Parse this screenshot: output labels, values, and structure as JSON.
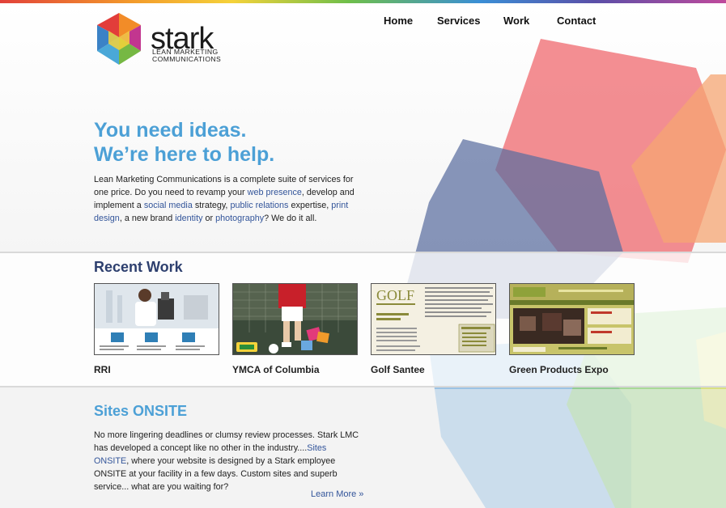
{
  "brand": {
    "wordmark": "stark",
    "tagline_line1": "LEAN MARKETING",
    "tagline_line2": "COMMUNICATIONS"
  },
  "nav": {
    "items": [
      {
        "label": "Home"
      },
      {
        "label": "Services"
      },
      {
        "label": "Work"
      },
      {
        "label": "Contact"
      }
    ]
  },
  "hero": {
    "title_line1": "You need ideas.",
    "title_line2": "We’re here to help.",
    "text_1": "Lean Marketing Communications is a complete suite of services for one price. Do you need to revamp your ",
    "link_web": "web presence",
    "text_2": ", develop and implement a ",
    "link_social": "social media",
    "text_3": " strategy, ",
    "link_pr": "public relations",
    "text_4": " expertise, ",
    "link_print": "print design",
    "text_5": ", a new brand ",
    "link_identity": "identity",
    "text_6": " or ",
    "link_photo": "photography",
    "text_7": "? We do it all."
  },
  "recent_work": {
    "title": "Recent Work",
    "items": [
      {
        "label": "RRI"
      },
      {
        "label": "YMCA of Columbia"
      },
      {
        "label": "Golf Santee"
      },
      {
        "label": "Green Products Expo"
      }
    ]
  },
  "onsite": {
    "title": "Sites ONSITE",
    "text_1": "No more lingering deadlines or clumsy review processes. Stark LMC has developed a concept like no other in the industry....",
    "link": "Sites ONSITE",
    "text_2": ", where your website is designed by a Stark employee ONSITE at your facility in a few days. Custom sites and superb service... what are you waiting for?",
    "learn_more": "Learn More »"
  },
  "colors": {
    "accent_blue": "#4ca0d6",
    "heading_navy": "#2d3f6e",
    "link": "#33559a"
  }
}
